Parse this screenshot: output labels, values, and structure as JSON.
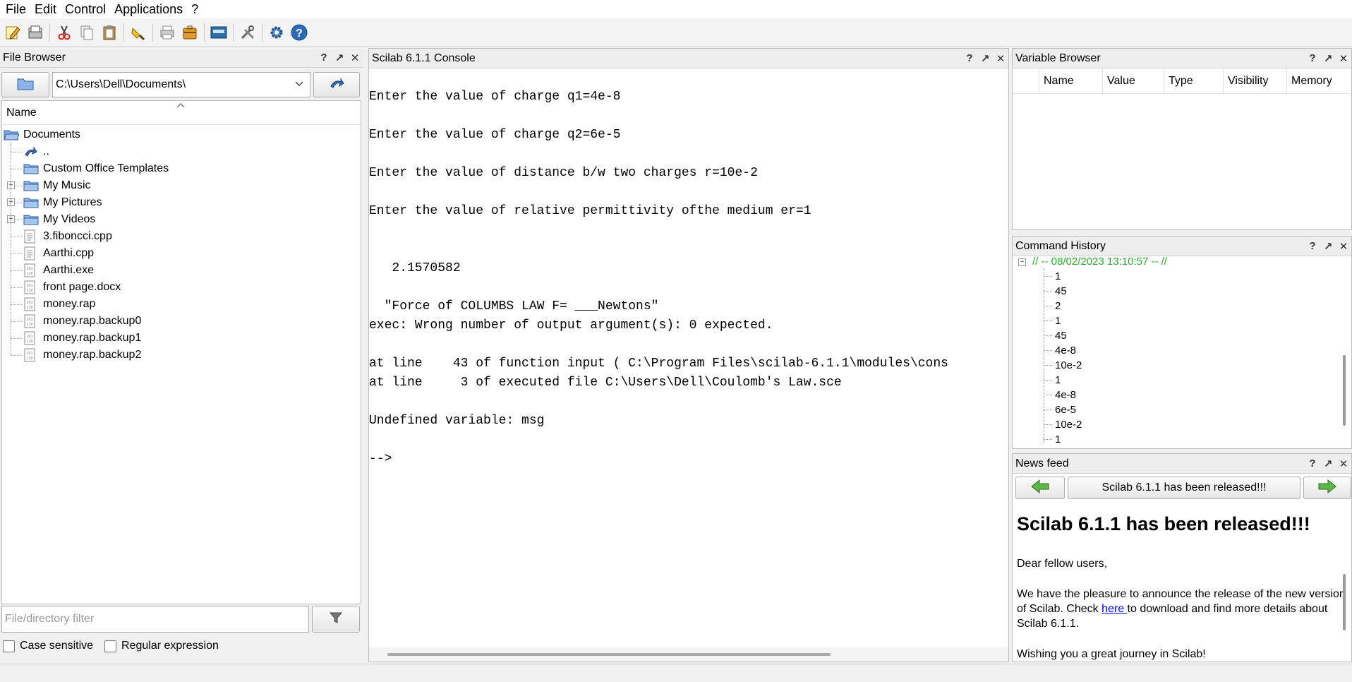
{
  "menubar": {
    "items": [
      "File",
      "Edit",
      "Control",
      "Applications",
      "?"
    ]
  },
  "toolbar": {
    "buttons": [
      "new-script-icon",
      "open-file-icon",
      "cut-icon",
      "copy-icon",
      "paste-icon",
      "clear-console-icon",
      "print-icon",
      "open-suitcase-icon",
      "variable-browser-icon",
      "tools-icon",
      "gear-icon",
      "help-icon"
    ]
  },
  "file_browser": {
    "title": "File Browser",
    "path": "C:\\Users\\Dell\\Documents\\",
    "column_name": "Name",
    "tree": [
      {
        "label": "Documents",
        "icon": "folder-open-icon"
      },
      {
        "label": "..",
        "icon": "up-arrow-icon"
      },
      {
        "label": "Custom Office Templates",
        "icon": "folder-icon"
      },
      {
        "label": "My Music",
        "icon": "folder-icon"
      },
      {
        "label": "My Pictures",
        "icon": "folder-icon"
      },
      {
        "label": "My Videos",
        "icon": "folder-icon"
      },
      {
        "label": "3.fiboncci.cpp",
        "icon": "text-file-icon"
      },
      {
        "label": "Aarthi.cpp",
        "icon": "text-file-icon"
      },
      {
        "label": "Aarthi.exe",
        "icon": "binary-file-icon"
      },
      {
        "label": "front page.docx",
        "icon": "binary-file-icon"
      },
      {
        "label": "money.rap",
        "icon": "binary-file-icon"
      },
      {
        "label": "money.rap.backup0",
        "icon": "binary-file-icon"
      },
      {
        "label": "money.rap.backup1",
        "icon": "binary-file-icon"
      },
      {
        "label": "money.rap.backup2",
        "icon": "binary-file-icon"
      }
    ],
    "filter_placeholder": "File/directory filter",
    "case_sensitive": "Case sensitive",
    "regex": "Regular expression"
  },
  "console": {
    "title": "Scilab 6.1.1 Console",
    "lines": [
      "Enter the value of charge q1=4e-8",
      "Enter the value of charge q2=6e-5",
      "Enter the value of distance b/w two charges r=10e-2",
      "Enter the value of relative permittivity ofthe medium er=1",
      "   2.1570582",
      "  \"Force of COLUMBS LAW F= ___Newtons\"",
      "exec: Wrong number of output argument(s): 0 expected.",
      "at line    43 of function input ( C:\\Program Files\\scilab-6.1.1\\modules\\cons",
      "at line     3 of executed file C:\\Users\\Dell\\Coulomb's Law.sce",
      "Undefined variable: msg",
      "-->"
    ]
  },
  "variable_browser": {
    "title": "Variable Browser",
    "columns": [
      "Name",
      "Value",
      "Type",
      "Visibility",
      "Memory"
    ]
  },
  "command_history": {
    "title": "Command History",
    "session": "// -- 08/02/2023 13:10:57 -- //",
    "entries": [
      "1",
      "45",
      "2",
      "1",
      "45",
      "4e-8",
      "10e-2",
      "1",
      "4e-8",
      "6e-5",
      "10e-2",
      "1"
    ]
  },
  "news_feed": {
    "title": "News feed",
    "item_title": "Scilab 6.1.1 has been released!!!",
    "heading": "Scilab 6.1.1 has been released!!!",
    "greeting": "Dear fellow users,",
    "body_pre": "We have the pleasure to announce the release of the new version of Scilab. Check ",
    "link": "here ",
    "body_post": "to download and find more details about Scilab 6.1.1.",
    "closing": "Wishing you a great journey in Scilab!"
  },
  "panel_controls": {
    "help": "?",
    "undock": "↗",
    "close": "✕"
  }
}
